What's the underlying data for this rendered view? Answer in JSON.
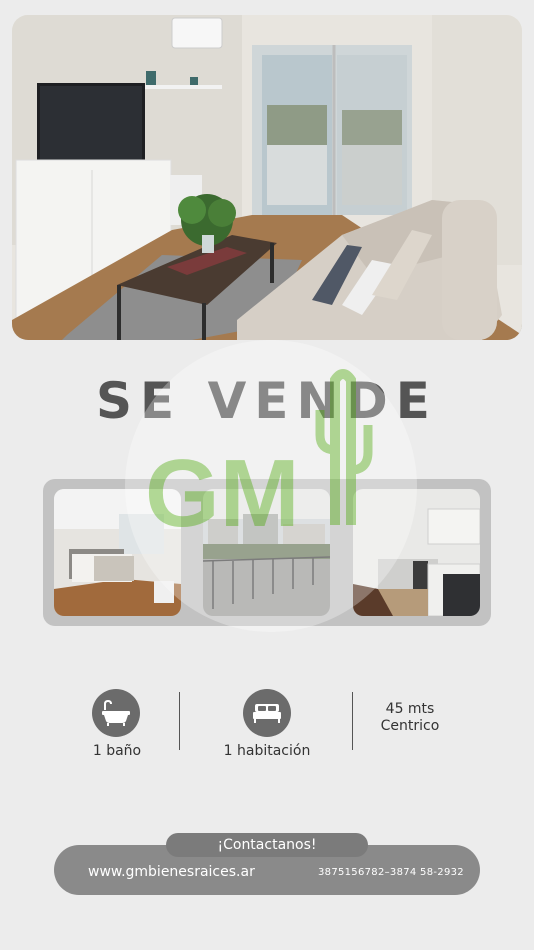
{
  "headline": "SE VENDE",
  "watermark": {
    "logo_text": "GM"
  },
  "hero": {
    "alt": "living room photo"
  },
  "gallery": [
    {
      "kind": "bedroom"
    },
    {
      "kind": "balcony"
    },
    {
      "kind": "kitchen"
    }
  ],
  "features": {
    "bath": {
      "icon": "bathtub-icon",
      "label": "1 baño"
    },
    "bedroom": {
      "icon": "bed-icon",
      "label": "1 habitación"
    },
    "size": {
      "line1": "45 mts",
      "line2": "Centrico"
    }
  },
  "contact": {
    "title": "¡Contactanos!",
    "website": "www.gmbienesraices.ar",
    "phones": "3875156782–3874 58-2932"
  },
  "colors": {
    "background": "#ececec",
    "accent_green": "#7cc24a",
    "pill": "#8a8a8a"
  }
}
